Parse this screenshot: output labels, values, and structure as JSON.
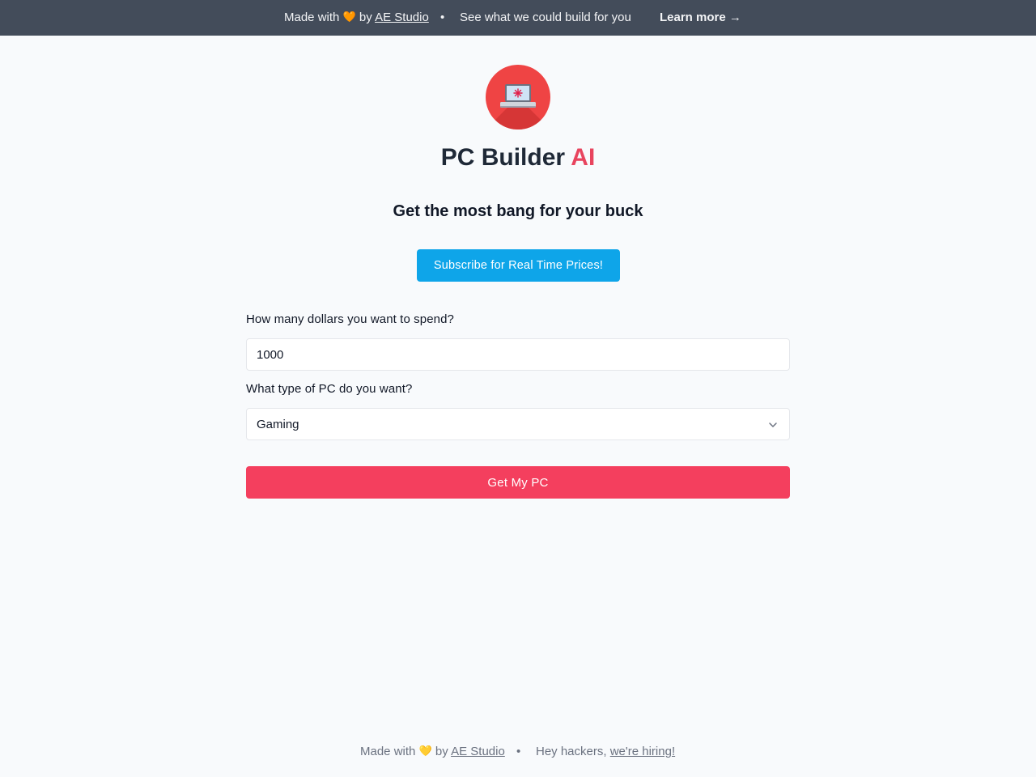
{
  "banner": {
    "made_prefix": "Made with",
    "heart": "🧡",
    "by": "by",
    "studio_link": "AE Studio",
    "separator": "•",
    "pitch": "See what we could build for you",
    "learn_more": "Learn more →"
  },
  "logo": {
    "icon": "laptop-icon",
    "bg_color": "#ef4444"
  },
  "header": {
    "title_main": "PC Builder",
    "title_accent": "AI",
    "subtitle": "Get the most bang for your buck"
  },
  "subscribe_button": "Subscribe for Real Time Prices!",
  "form": {
    "budget_label": "How many dollars you want to spend?",
    "budget_value": "1000",
    "type_label": "What type of PC do you want?",
    "type_value": "Gaming",
    "submit_label": "Get My PC"
  },
  "footer": {
    "made_prefix": "Made with",
    "heart": "💛",
    "by": "by",
    "studio_link": "AE Studio",
    "separator": "•",
    "hackers": "Hey hackers,",
    "hiring_link": "we're hiring!"
  },
  "colors": {
    "banner_bg": "#434c5a",
    "accent_pink": "#e8445e",
    "subscribe_blue": "#0ea5e9",
    "submit_red": "#f43f5e"
  }
}
